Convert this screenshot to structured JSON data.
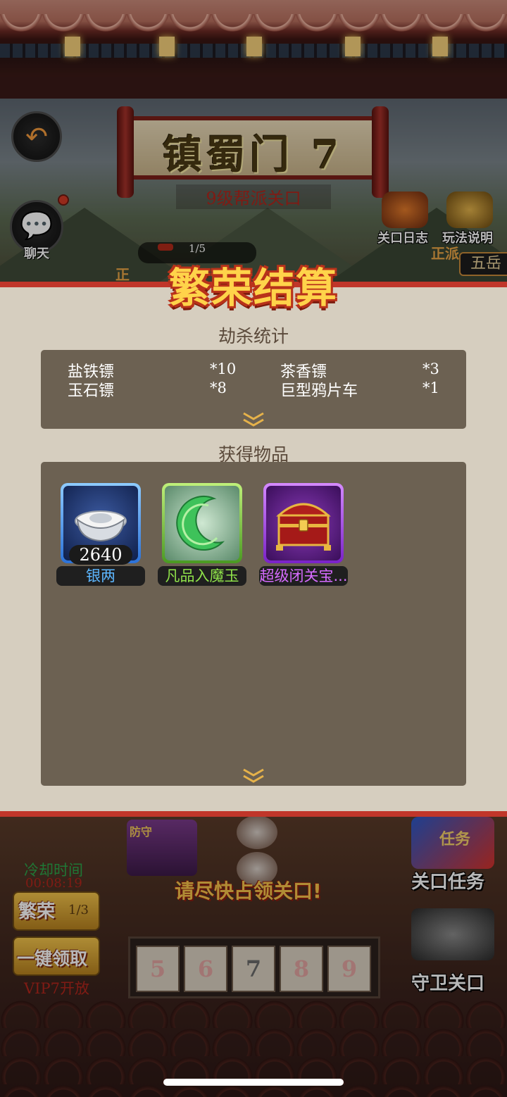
{
  "stage": {
    "title": "镇蜀门 7",
    "subtitle": "9级帮派关口",
    "progress_text": "1/5",
    "progress_fraction": 0.2,
    "chat_label": "聊天",
    "gate_log_label": "关口日志",
    "rules_label": "玩法说明",
    "side_tag": "正派",
    "left_tag": "正",
    "faction_button": "五岳"
  },
  "dialog": {
    "title": "繁荣结算",
    "robbery_section_title": "劫杀统计",
    "robbery_stats": [
      {
        "name": "盐铁镖",
        "count": "*10"
      },
      {
        "name": "茶香镖",
        "count": "*3"
      },
      {
        "name": "玉石镖",
        "count": "*8"
      },
      {
        "name": "巨型鸦片车",
        "count": "*1"
      }
    ],
    "rewards_section_title": "获得物品",
    "rewards": [
      {
        "name": "银两",
        "count": "2640",
        "rarity": "blue",
        "icon": "silver-ingot-icon",
        "name_color": "#5db7ff"
      },
      {
        "name": "凡品入魔玉",
        "count": "",
        "rarity": "green",
        "icon": "green-moon-jade-icon",
        "name_color": "#8fe24a"
      },
      {
        "name": "超级闭关宝...",
        "count": "",
        "rarity": "purple",
        "icon": "treasure-chest-icon",
        "name_color": "#d66bff"
      }
    ]
  },
  "bottom": {
    "cooldown_label": "冷却时间",
    "cooldown_time": "00:08:19",
    "prosperity_button": "繁荣",
    "prosperity_count": "1/3",
    "claim_all_button": "一键领取",
    "vip_note": "VIP7开放",
    "occupy_prompt": "请尽快占领关口!",
    "gate_slots": [
      "5",
      "6",
      "7",
      "8",
      "9"
    ],
    "active_slot": "7",
    "cart_flag": "防守",
    "gate_task_label": "关口任务",
    "task_icon_text": "任务",
    "guard_gate_label": "守卫关口"
  },
  "colors": {
    "panel_bg": "#d6cebf",
    "panel_border": "#c0362a",
    "stat_box": "#6c6152",
    "title_gold": "#ffd34a"
  }
}
